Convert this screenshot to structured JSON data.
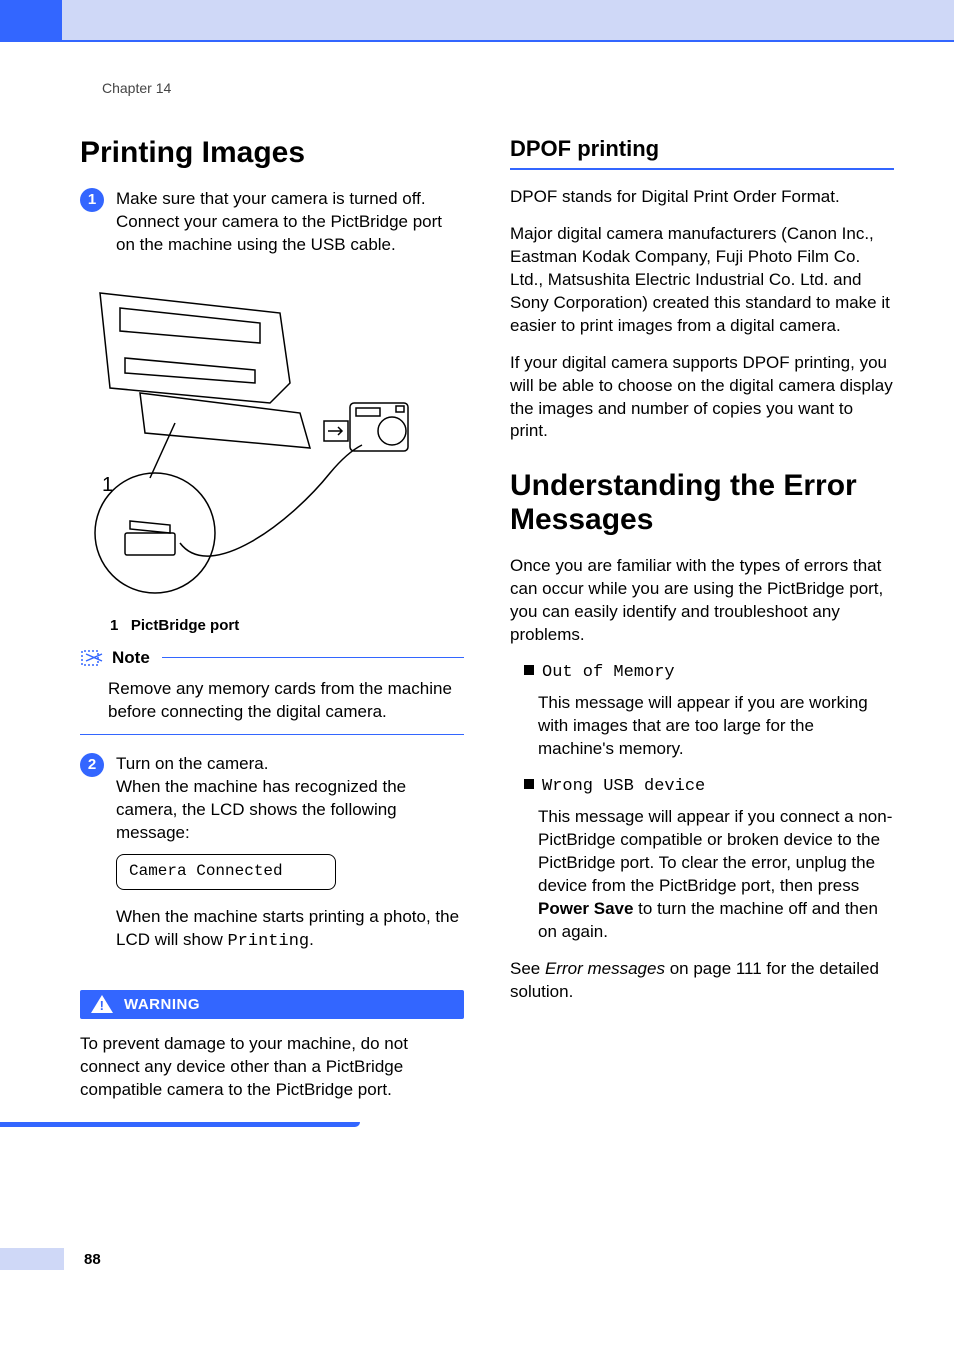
{
  "chapter": "Chapter 14",
  "page_number": "88",
  "left": {
    "heading": "Printing Images",
    "steps": [
      {
        "num": "1",
        "text": "Make sure that your camera is turned off. Connect your camera to the PictBridge port on the machine using the USB cable."
      },
      {
        "num": "2",
        "text_line1": "Turn on the camera.",
        "text_line2": "When the machine has recognized the camera, the LCD shows the following message:"
      }
    ],
    "figure_caption_num": "1",
    "figure_caption_text": "PictBridge port",
    "figure_callout": "1",
    "note_label": "Note",
    "note_body": "Remove any memory cards from the machine before connecting the digital camera.",
    "lcd_message": "Camera Connected",
    "after_lcd_prefix": "When the machine starts printing a photo, the LCD will show ",
    "after_lcd_code": "Printing",
    "after_lcd_suffix": ".",
    "warning_label": "WARNING",
    "warning_body": "To prevent damage to your machine, do not connect any device other than a PictBridge compatible camera to the PictBridge port."
  },
  "right": {
    "dpof_heading": "DPOF printing",
    "dpof_p1": "DPOF stands for Digital Print Order Format.",
    "dpof_p2": "Major digital camera manufacturers (Canon Inc., Eastman Kodak Company, Fuji Photo Film Co. Ltd., Matsushita Electric Industrial Co. Ltd. and Sony Corporation) created this standard to make it easier to print images from a digital camera.",
    "dpof_p3": "If your digital camera supports DPOF printing, you will be able to choose on the digital camera display the images and number of copies you want to print.",
    "err_heading": "Understanding the Error Messages",
    "err_intro": "Once you are familiar with the types of errors that can occur while you are using the PictBridge port, you can easily identify and troubleshoot any problems.",
    "errors": [
      {
        "name": "Out of Memory",
        "desc": "This message will appear if you are working with images that are too large for the machine's memory."
      },
      {
        "name": "Wrong USB device",
        "desc_prefix": "This message will appear if you connect a non-PictBridge compatible or broken device to the PictBridge port. To clear the error, unplug the device from the PictBridge port, then press ",
        "desc_bold": "Power Save",
        "desc_suffix": " to turn the machine off and then on again."
      }
    ],
    "see_prefix": "See ",
    "see_italic": "Error messages",
    "see_suffix": " on page 111 for the detailed solution."
  }
}
